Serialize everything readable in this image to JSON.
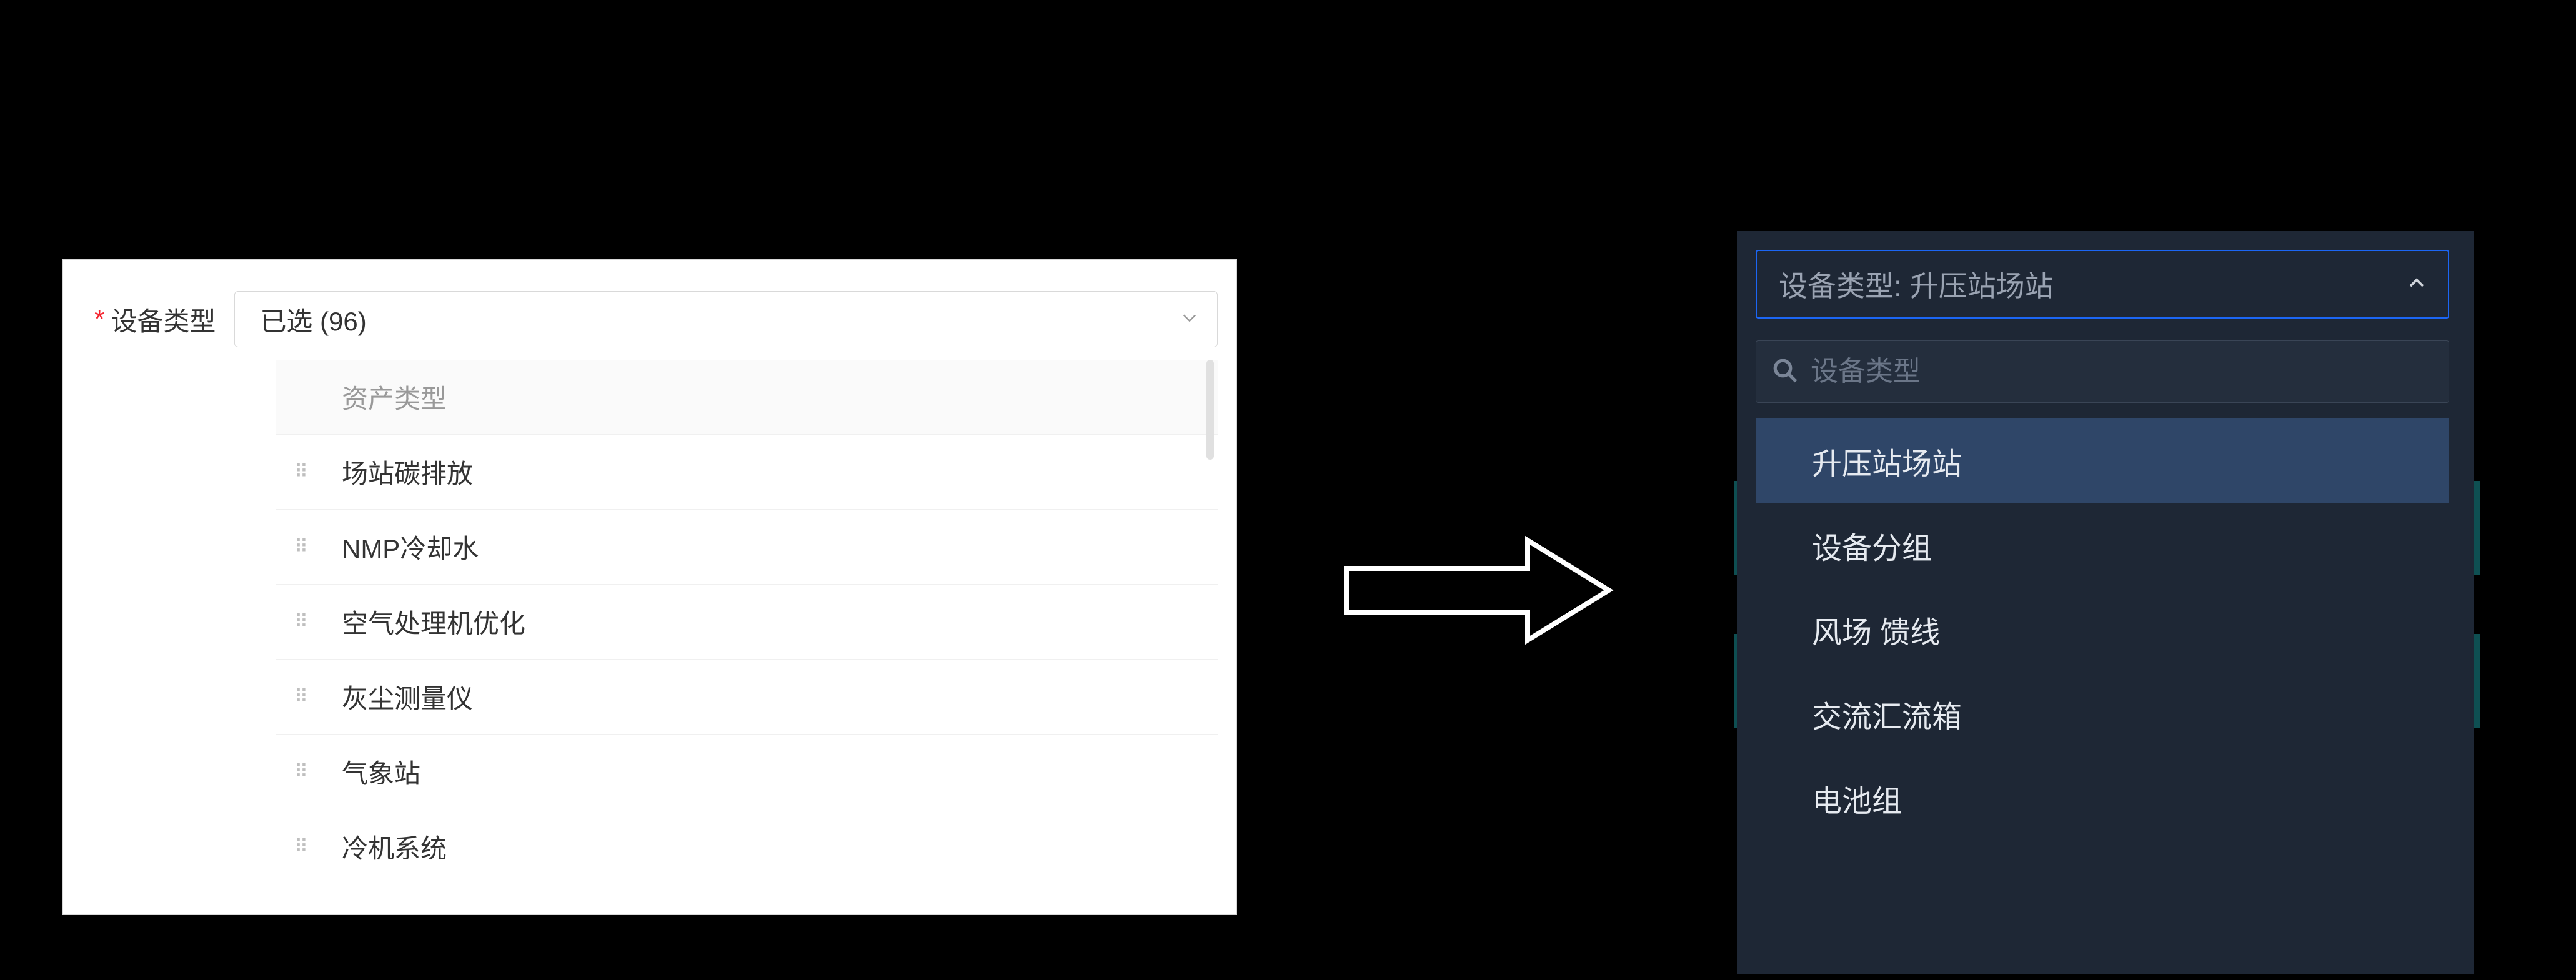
{
  "left": {
    "required_mark": "*",
    "label": "设备类型",
    "selected_summary": "已选 (96)",
    "header": "资产类型",
    "items": [
      "场站碳排放",
      "NMP冷却水",
      "空气处理机优化",
      "灰尘测量仪",
      "气象站",
      "冷机系统"
    ]
  },
  "right": {
    "select_prefix": "设备类型: ",
    "select_value": "升压站场站",
    "search_placeholder": "设备类型",
    "options": [
      {
        "label": "升压站场站",
        "selected": true
      },
      {
        "label": "设备分组",
        "selected": false
      },
      {
        "label": "风场 馈线",
        "selected": false
      },
      {
        "label": "交流汇流箱",
        "selected": false
      },
      {
        "label": "电池组",
        "selected": false
      }
    ]
  }
}
